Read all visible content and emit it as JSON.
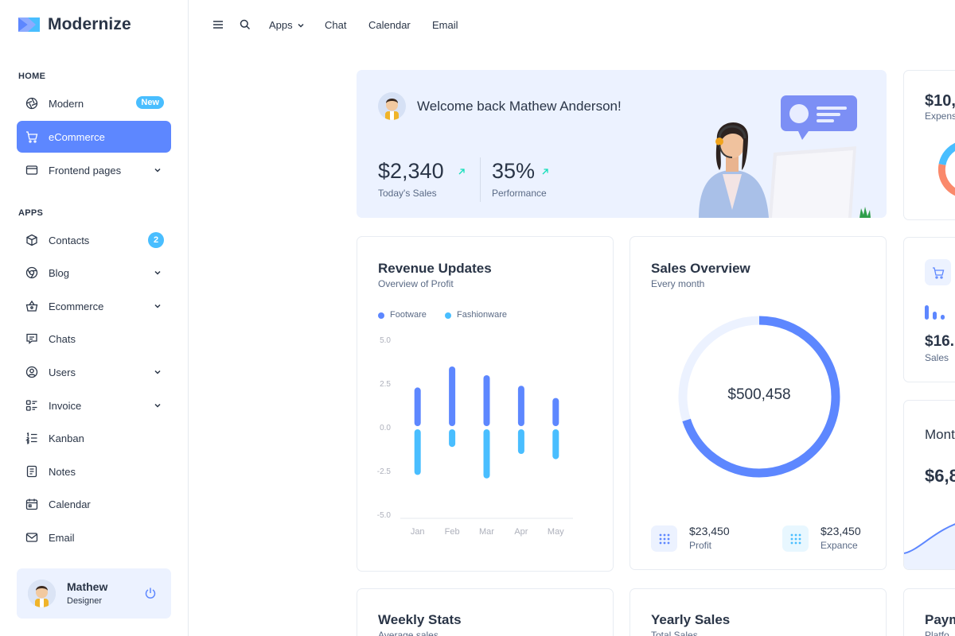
{
  "brand": {
    "name": "Modernize"
  },
  "sidebar": {
    "section_home": "HOME",
    "section_apps": "APPS",
    "items": [
      {
        "label": "Modern",
        "badge": "New"
      },
      {
        "label": "eCommerce"
      },
      {
        "label": "Frontend pages"
      },
      {
        "label": "Contacts",
        "badge": "2"
      },
      {
        "label": "Blog"
      },
      {
        "label": "Ecommerce"
      },
      {
        "label": "Chats"
      },
      {
        "label": "Users"
      },
      {
        "label": "Invoice"
      },
      {
        "label": "Kanban"
      },
      {
        "label": "Notes"
      },
      {
        "label": "Calendar"
      },
      {
        "label": "Email"
      }
    ],
    "profile": {
      "name": "Mathew",
      "role": "Designer"
    }
  },
  "topbar": {
    "apps": "Apps",
    "chat": "Chat",
    "calendar": "Calendar",
    "email": "Email"
  },
  "welcome": {
    "greeting": "Welcome back Mathew Anderson!",
    "sales_value": "$2,340",
    "sales_label": "Today's Sales",
    "perf_value": "35%",
    "perf_label": "Performance"
  },
  "revenue": {
    "title": "Revenue Updates",
    "subtitle": "Overview of Profit",
    "legend": [
      "Footware",
      "Fashionware"
    ]
  },
  "sales_overview": {
    "title": "Sales Overview",
    "subtitle": "Every month",
    "center": "$500,458",
    "profit_value": "$23,450",
    "profit_label": "Profit",
    "expense_value": "$23,450",
    "expense_label": "Expance"
  },
  "bottom": {
    "weekly": "Weekly Stats",
    "weekly_sub": "Average sales",
    "yearly": "Yearly Sales",
    "yearly_sub": "Total Sales",
    "payments": "Paym",
    "payments_sub": "Platfo"
  },
  "right_partial": {
    "val1": "$10,",
    "lbl1": "Expens",
    "val2": "$16.",
    "lbl2": "Sales",
    "title3": "Mont",
    "val3": "$6,8"
  },
  "colors": {
    "primary": "#5d87ff",
    "secondary": "#49beff",
    "light": "#ecf2ff"
  },
  "chart_data": {
    "type": "bar",
    "categories": [
      "Jan",
      "Feb",
      "Mar",
      "Apr",
      "May"
    ],
    "ylim": [
      -5,
      5
    ],
    "yticks": [
      "5.0",
      "2.5",
      "0.0",
      "-2.5",
      "-5.0"
    ],
    "series": [
      {
        "name": "Footware",
        "values": [
          2.3,
          3.5,
          3.0,
          2.4,
          1.7
        ]
      },
      {
        "name": "Fashionware",
        "values": [
          -2.7,
          -1.1,
          -2.9,
          -1.5,
          -1.8
        ]
      }
    ]
  },
  "donut": {
    "primary_fraction": 0.7,
    "secondary_fraction": 0.15
  }
}
